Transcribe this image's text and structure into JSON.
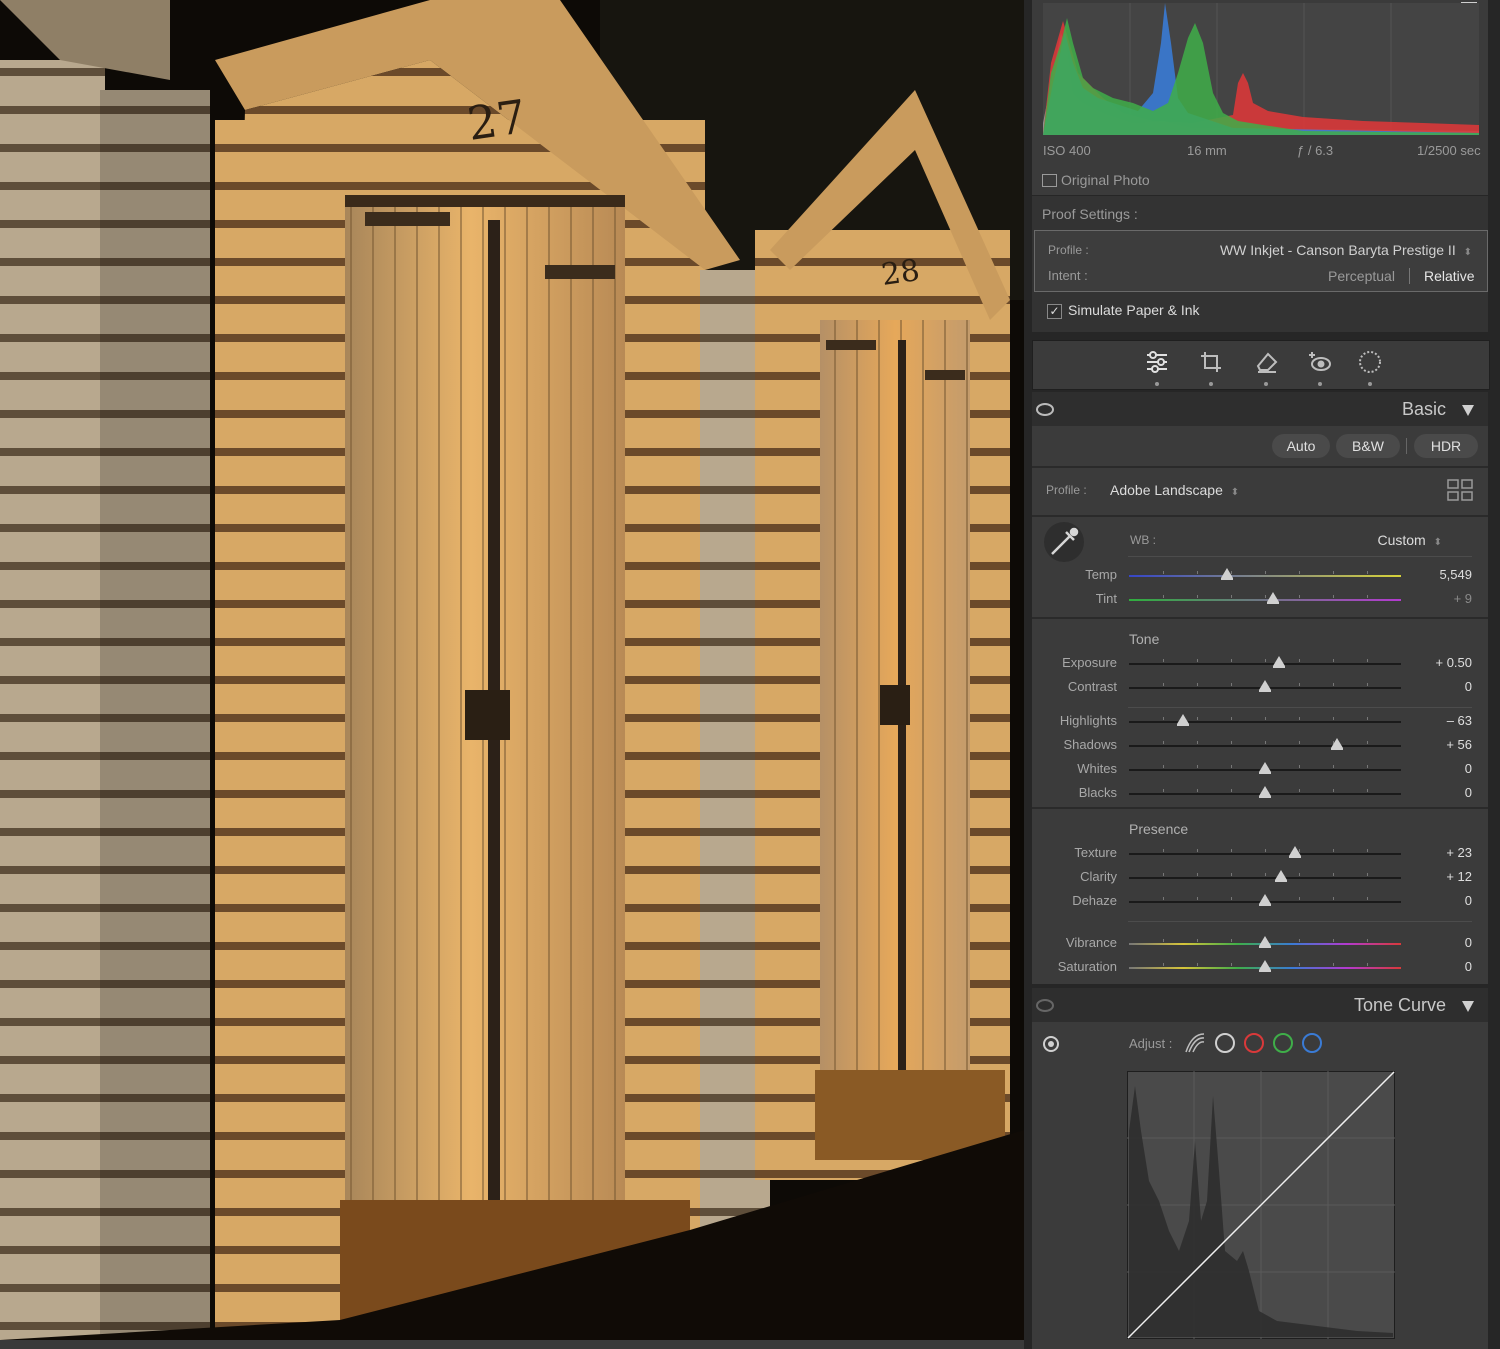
{
  "histogram": {
    "iso": "ISO 400",
    "focal": "16 mm",
    "aperture": "ƒ / 6.3",
    "shutter": "1/2500 sec"
  },
  "original_photo": {
    "label": "Original Photo",
    "checked": false
  },
  "proof": {
    "title": "Proof Settings :",
    "profile_label": "Profile :",
    "profile_value": "WW Inkjet - Canson Baryta Prestige II",
    "intent_label": "Intent :",
    "intent_options": [
      "Perceptual",
      "Relative"
    ],
    "intent_selected": "Relative",
    "simulate_label": "Simulate Paper & Ink",
    "simulate_checked": true
  },
  "tools": [
    "edit-sliders-icon",
    "crop-icon",
    "heal-eraser-icon",
    "red-eye-icon",
    "masking-icon"
  ],
  "basic": {
    "title": "Basic",
    "auto": "Auto",
    "bw": "B&W",
    "hdr": "HDR",
    "profile_label": "Profile :",
    "profile_value": "Adobe Landscape",
    "wb_label": "WB :",
    "wb_value": "Custom",
    "tone_title": "Tone",
    "presence_title": "Presence",
    "sliders": {
      "temp": {
        "label": "Temp",
        "value": "5,549",
        "level": 0.36
      },
      "tint": {
        "label": "Tint",
        "value": "+ 9",
        "level": 0.53
      },
      "exposure": {
        "label": "Exposure",
        "value": "+ 0.50",
        "level": 0.55
      },
      "contrast": {
        "label": "Contrast",
        "value": "0",
        "level": 0.5
      },
      "highlights": {
        "label": "Highlights",
        "value": "– 63",
        "level": 0.2
      },
      "shadows": {
        "label": "Shadows",
        "value": "+ 56",
        "level": 0.765
      },
      "whites": {
        "label": "Whites",
        "value": "0",
        "level": 0.5
      },
      "blacks": {
        "label": "Blacks",
        "value": "0",
        "level": 0.5
      },
      "texture": {
        "label": "Texture",
        "value": "+ 23",
        "level": 0.61
      },
      "clarity": {
        "label": "Clarity",
        "value": "+ 12",
        "level": 0.56
      },
      "dehaze": {
        "label": "Dehaze",
        "value": "0",
        "level": 0.5
      },
      "vibrance": {
        "label": "Vibrance",
        "value": "0",
        "level": 0.5
      },
      "saturation": {
        "label": "Saturation",
        "value": "0",
        "level": 0.5
      }
    }
  },
  "tone_curve": {
    "title": "Tone Curve",
    "adjust_label": "Adjust :",
    "channels": [
      "parametric-icon",
      "rgb-point-icon",
      "red-channel-icon",
      "green-channel-icon",
      "blue-channel-icon"
    ]
  },
  "colors": {
    "accent_red": "#d9393a",
    "accent_green": "#3fae49",
    "accent_blue": "#3a7bd5"
  }
}
